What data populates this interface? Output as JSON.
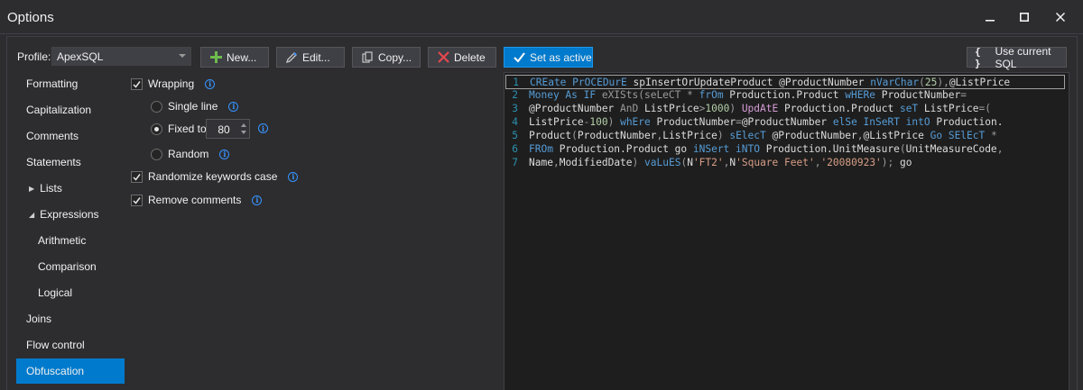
{
  "window": {
    "title": "Options",
    "controls": [
      "minimize",
      "maximize",
      "close"
    ]
  },
  "profile": {
    "label": "Profile:",
    "selected": "ApexSQL"
  },
  "toolbar": {
    "new_label": "New...",
    "edit_label": "Edit...",
    "copy_label": "Copy...",
    "delete_label": "Delete",
    "set_active_label": "Set as active",
    "use_current_label": "Use current SQL",
    "use_current_icon": "{ }"
  },
  "nav": {
    "items": [
      {
        "label": "Formatting"
      },
      {
        "label": "Capitalization"
      },
      {
        "label": "Comments"
      },
      {
        "label": "Statements"
      },
      {
        "label": "Lists",
        "expander": "collapsed"
      },
      {
        "label": "Expressions",
        "expander": "expanded"
      },
      {
        "label": "Arithmetic"
      },
      {
        "label": "Comparison"
      },
      {
        "label": "Logical"
      },
      {
        "label": "Joins"
      },
      {
        "label": "Flow control"
      },
      {
        "label": "Obfuscation",
        "selected": true
      }
    ],
    "arrow_collapsed": "▶",
    "arrow_expanded": "◢"
  },
  "options": {
    "wrapping": {
      "label": "Wrapping",
      "checked": true
    },
    "single_line": {
      "label": "Single line",
      "checked": false
    },
    "fixed_to": {
      "label": "Fixed to",
      "checked": true,
      "value": "80"
    },
    "random": {
      "label": "Random",
      "checked": false
    },
    "randomize_keywords": {
      "label": "Randomize keywords case",
      "checked": true
    },
    "remove_comments": {
      "label": "Remove comments",
      "checked": true
    },
    "info_glyph": "i"
  },
  "editor": {
    "lines": [
      {
        "n": "1",
        "tokens": [
          [
            "k",
            "CREate PrOCEDurE "
          ],
          [
            "w",
            "spInsertOrUpdateProduct @ProductNumber "
          ],
          [
            "k",
            "nVarChar"
          ],
          [
            "g",
            "("
          ],
          [
            "n",
            "25"
          ],
          [
            "g",
            "),"
          ],
          [
            "w",
            "@ListPrice"
          ]
        ]
      },
      {
        "n": "2",
        "tokens": [
          [
            "k",
            "Money As IF "
          ],
          [
            "g",
            "eXISts(seLeCT * "
          ],
          [
            "k",
            "frOm "
          ],
          [
            "w",
            "Production.Product "
          ],
          [
            "k",
            "wHERe "
          ],
          [
            "w",
            "ProductNumber"
          ],
          [
            "g",
            "="
          ]
        ]
      },
      {
        "n": "3",
        "tokens": [
          [
            "w",
            "@ProductNumber "
          ],
          [
            "g",
            "AnD "
          ],
          [
            "w",
            "ListPrice"
          ],
          [
            "g",
            ">"
          ],
          [
            "n",
            "1000"
          ],
          [
            "g",
            ") "
          ],
          [
            "p",
            "UpdAtE "
          ],
          [
            "w",
            "Production.Product "
          ],
          [
            "k",
            "seT "
          ],
          [
            "w",
            "ListPrice"
          ],
          [
            "g",
            "=("
          ]
        ]
      },
      {
        "n": "4",
        "tokens": [
          [
            "w",
            "ListPrice"
          ],
          [
            "g",
            "-"
          ],
          [
            "n",
            "100"
          ],
          [
            "g",
            ") "
          ],
          [
            "k",
            "whEre "
          ],
          [
            "w",
            "ProductNumber"
          ],
          [
            "g",
            "="
          ],
          [
            "w",
            "@ProductNumber "
          ],
          [
            "k",
            "elSe InSeRT intO "
          ],
          [
            "w",
            "Production."
          ]
        ]
      },
      {
        "n": "5",
        "tokens": [
          [
            "w",
            "Product"
          ],
          [
            "g",
            "("
          ],
          [
            "w",
            "ProductNumber"
          ],
          [
            "g",
            ","
          ],
          [
            "w",
            "ListPrice"
          ],
          [
            "g",
            ") "
          ],
          [
            "k",
            "sElecT "
          ],
          [
            "w",
            "@ProductNumber"
          ],
          [
            "g",
            ","
          ],
          [
            "w",
            "@ListPrice "
          ],
          [
            "k",
            "Go SElEcT "
          ],
          [
            "g",
            "*"
          ]
        ]
      },
      {
        "n": "6",
        "tokens": [
          [
            "k",
            "FROm "
          ],
          [
            "w",
            "Production.Product go "
          ],
          [
            "k",
            "iNSert iNTO "
          ],
          [
            "w",
            "Production.UnitMeasure"
          ],
          [
            "g",
            "("
          ],
          [
            "w",
            "UnitMeasureCode"
          ],
          [
            "g",
            ","
          ]
        ]
      },
      {
        "n": "7",
        "tokens": [
          [
            "w",
            "Name"
          ],
          [
            "g",
            ","
          ],
          [
            "w",
            "ModifiedDate"
          ],
          [
            "g",
            ") "
          ],
          [
            "k",
            "vaLuES"
          ],
          [
            "g",
            "("
          ],
          [
            "w",
            "N"
          ],
          [
            "s",
            "'FT2'"
          ],
          [
            "g",
            ","
          ],
          [
            "w",
            "N"
          ],
          [
            "s",
            "'Square Feet'"
          ],
          [
            "g",
            ","
          ],
          [
            "s",
            "'20080923'"
          ],
          [
            "g",
            "); "
          ],
          [
            "w",
            "go"
          ]
        ]
      }
    ]
  }
}
